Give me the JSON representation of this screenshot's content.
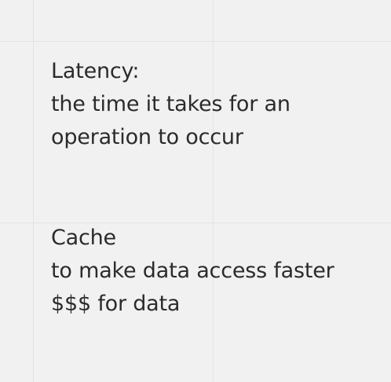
{
  "notes": {
    "latency": {
      "lines": [
        "Latency:",
        "the time it takes for an",
        "operation to occur"
      ]
    },
    "cache": {
      "lines": [
        "Cache",
        "to make data access faster",
        "$$$ for data"
      ]
    }
  }
}
